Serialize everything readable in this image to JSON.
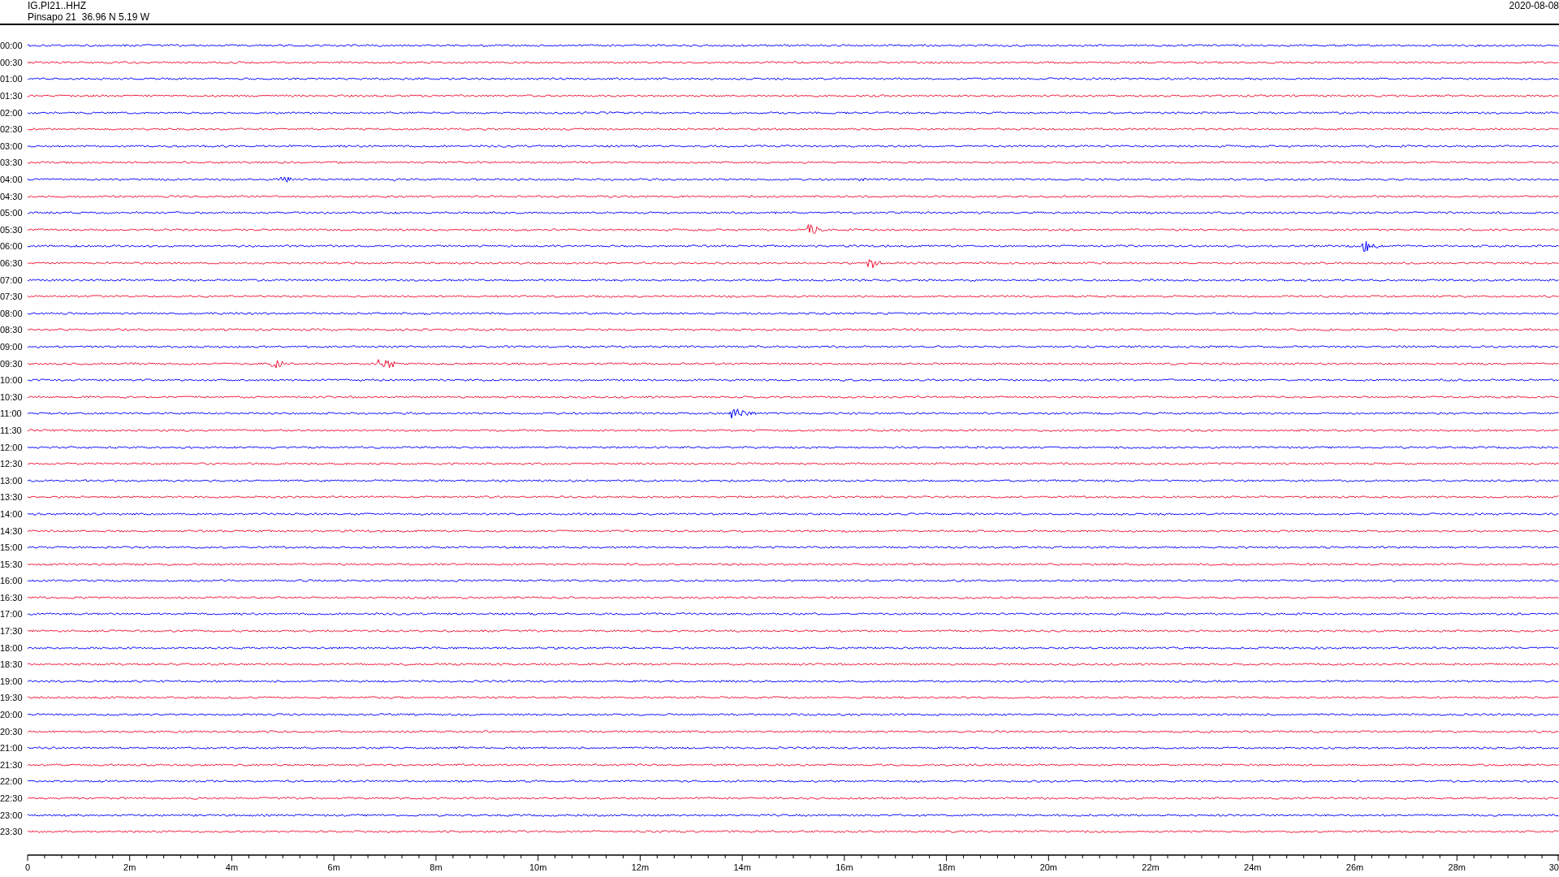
{
  "station": {
    "code": "IG.PI21..HHZ",
    "location": "Pinsapo 21  36.96 N 5.19 W",
    "date": "2020-08-08"
  },
  "traces": [
    {
      "label": "00:00",
      "color": "#0000ff"
    },
    {
      "label": "00:30",
      "color": "#ee1133"
    },
    {
      "label": "01:00",
      "color": "#0000ff"
    },
    {
      "label": "01:30",
      "color": "#ee1133"
    },
    {
      "label": "02:00",
      "color": "#0000ff"
    },
    {
      "label": "02:30",
      "color": "#ee1133"
    },
    {
      "label": "03:00",
      "color": "#0000ff"
    },
    {
      "label": "03:30",
      "color": "#ee1133"
    },
    {
      "label": "04:00",
      "color": "#0000ff"
    },
    {
      "label": "04:30",
      "color": "#ee1133"
    },
    {
      "label": "05:00",
      "color": "#0000ff"
    },
    {
      "label": "05:30",
      "color": "#ee1133"
    },
    {
      "label": "06:00",
      "color": "#0000ff"
    },
    {
      "label": "06:30",
      "color": "#ee1133"
    },
    {
      "label": "07:00",
      "color": "#0000ff"
    },
    {
      "label": "07:30",
      "color": "#ee1133"
    },
    {
      "label": "08:00",
      "color": "#0000ff"
    },
    {
      "label": "08:30",
      "color": "#ee1133"
    },
    {
      "label": "09:00",
      "color": "#0000ff"
    },
    {
      "label": "09:30",
      "color": "#ee1133"
    },
    {
      "label": "10:00",
      "color": "#0000ff"
    },
    {
      "label": "10:30",
      "color": "#ee1133"
    },
    {
      "label": "11:00",
      "color": "#0000ff"
    },
    {
      "label": "11:30",
      "color": "#ee1133"
    },
    {
      "label": "12:00",
      "color": "#0000ff"
    },
    {
      "label": "12:30",
      "color": "#ee1133"
    },
    {
      "label": "13:00",
      "color": "#0000ff"
    },
    {
      "label": "13:30",
      "color": "#ee1133"
    },
    {
      "label": "14:00",
      "color": "#0000ff"
    },
    {
      "label": "14:30",
      "color": "#ee1133"
    },
    {
      "label": "15:00",
      "color": "#0000ff"
    },
    {
      "label": "15:30",
      "color": "#ee1133"
    },
    {
      "label": "16:00",
      "color": "#0000ff"
    },
    {
      "label": "16:30",
      "color": "#ee1133"
    },
    {
      "label": "17:00",
      "color": "#0000ff"
    },
    {
      "label": "17:30",
      "color": "#ee1133"
    },
    {
      "label": "18:00",
      "color": "#0000ff"
    },
    {
      "label": "18:30",
      "color": "#ee1133"
    },
    {
      "label": "19:00",
      "color": "#0000ff"
    },
    {
      "label": "19:30",
      "color": "#ee1133"
    },
    {
      "label": "20:00",
      "color": "#0000ff"
    },
    {
      "label": "20:30",
      "color": "#ee1133"
    },
    {
      "label": "21:00",
      "color": "#0000ff"
    },
    {
      "label": "21:30",
      "color": "#ee1133"
    },
    {
      "label": "22:00",
      "color": "#0000ff"
    },
    {
      "label": "22:30",
      "color": "#ee1133"
    },
    {
      "label": "23:00",
      "color": "#0000ff"
    },
    {
      "label": "23:30",
      "color": "#ee1133"
    }
  ],
  "time_axis": {
    "ticks": [
      "0",
      "2m",
      "4m",
      "6m",
      "8m",
      "10m",
      "12m",
      "14m",
      "16m",
      "18m",
      "20m",
      "22m",
      "24m",
      "26m",
      "28m",
      "30"
    ]
  }
}
